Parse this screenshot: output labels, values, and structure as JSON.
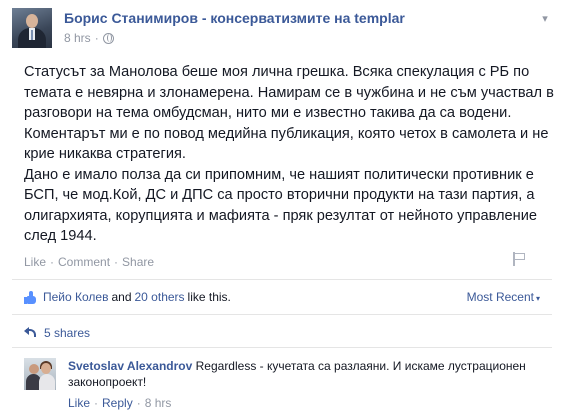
{
  "post": {
    "author": "Борис Станимиров",
    "separator": " - ",
    "page_name": "консерватизмите на templar",
    "time": "8 hrs",
    "meta_dot": "·",
    "paragraph1": "Статусът за Манолова беше моя лична грешка. Всяка спекулация с РБ по темата е невярна и злонамерена. Намирам се в чужбина и не съм участвал в разговори на тема омбудсман, нито ми е известно такива да са водени. Коментарът ми е по повод медийна публикация, която четох в самолета и не крие никаква стратегия.",
    "paragraph2": "Дано е имало полза да си припомним, че нашият политически противник е БСП, че мод.Кой, ДС и ДПС са просто вторични продукти на тази партия, а олигархията, корупцията и мафията - пряк резултат от нейното управление след 1944."
  },
  "actions": {
    "like": "Like",
    "dot1": "·",
    "comment": "Comment",
    "dot2": "·",
    "share": "Share"
  },
  "likes": {
    "first_name": "Пейо Колев",
    "and_text": "and",
    "others": "20 others",
    "suffix": "like this.",
    "sort_label": "Most Recent",
    "sort_caret": "▾"
  },
  "shares": {
    "label": "5 shares"
  },
  "comment": {
    "author": "Svetoslav Alexandrov",
    "text": "Regardless - кучетата са разлаяни. И искаме лустрационен законопроект!",
    "like": "Like",
    "dot1": "·",
    "reply": "Reply",
    "dot2": "·",
    "time": "8 hrs"
  },
  "icons": {
    "menu": "chevron-down-icon",
    "audience": "globe-icon",
    "report": "flag-icon",
    "likes": "thumbs-up-icon",
    "shares": "share-icon"
  },
  "colors": {
    "link": "#3b5998",
    "muted": "#9197a3",
    "text": "#141823",
    "like_blue": "#5890ff"
  }
}
